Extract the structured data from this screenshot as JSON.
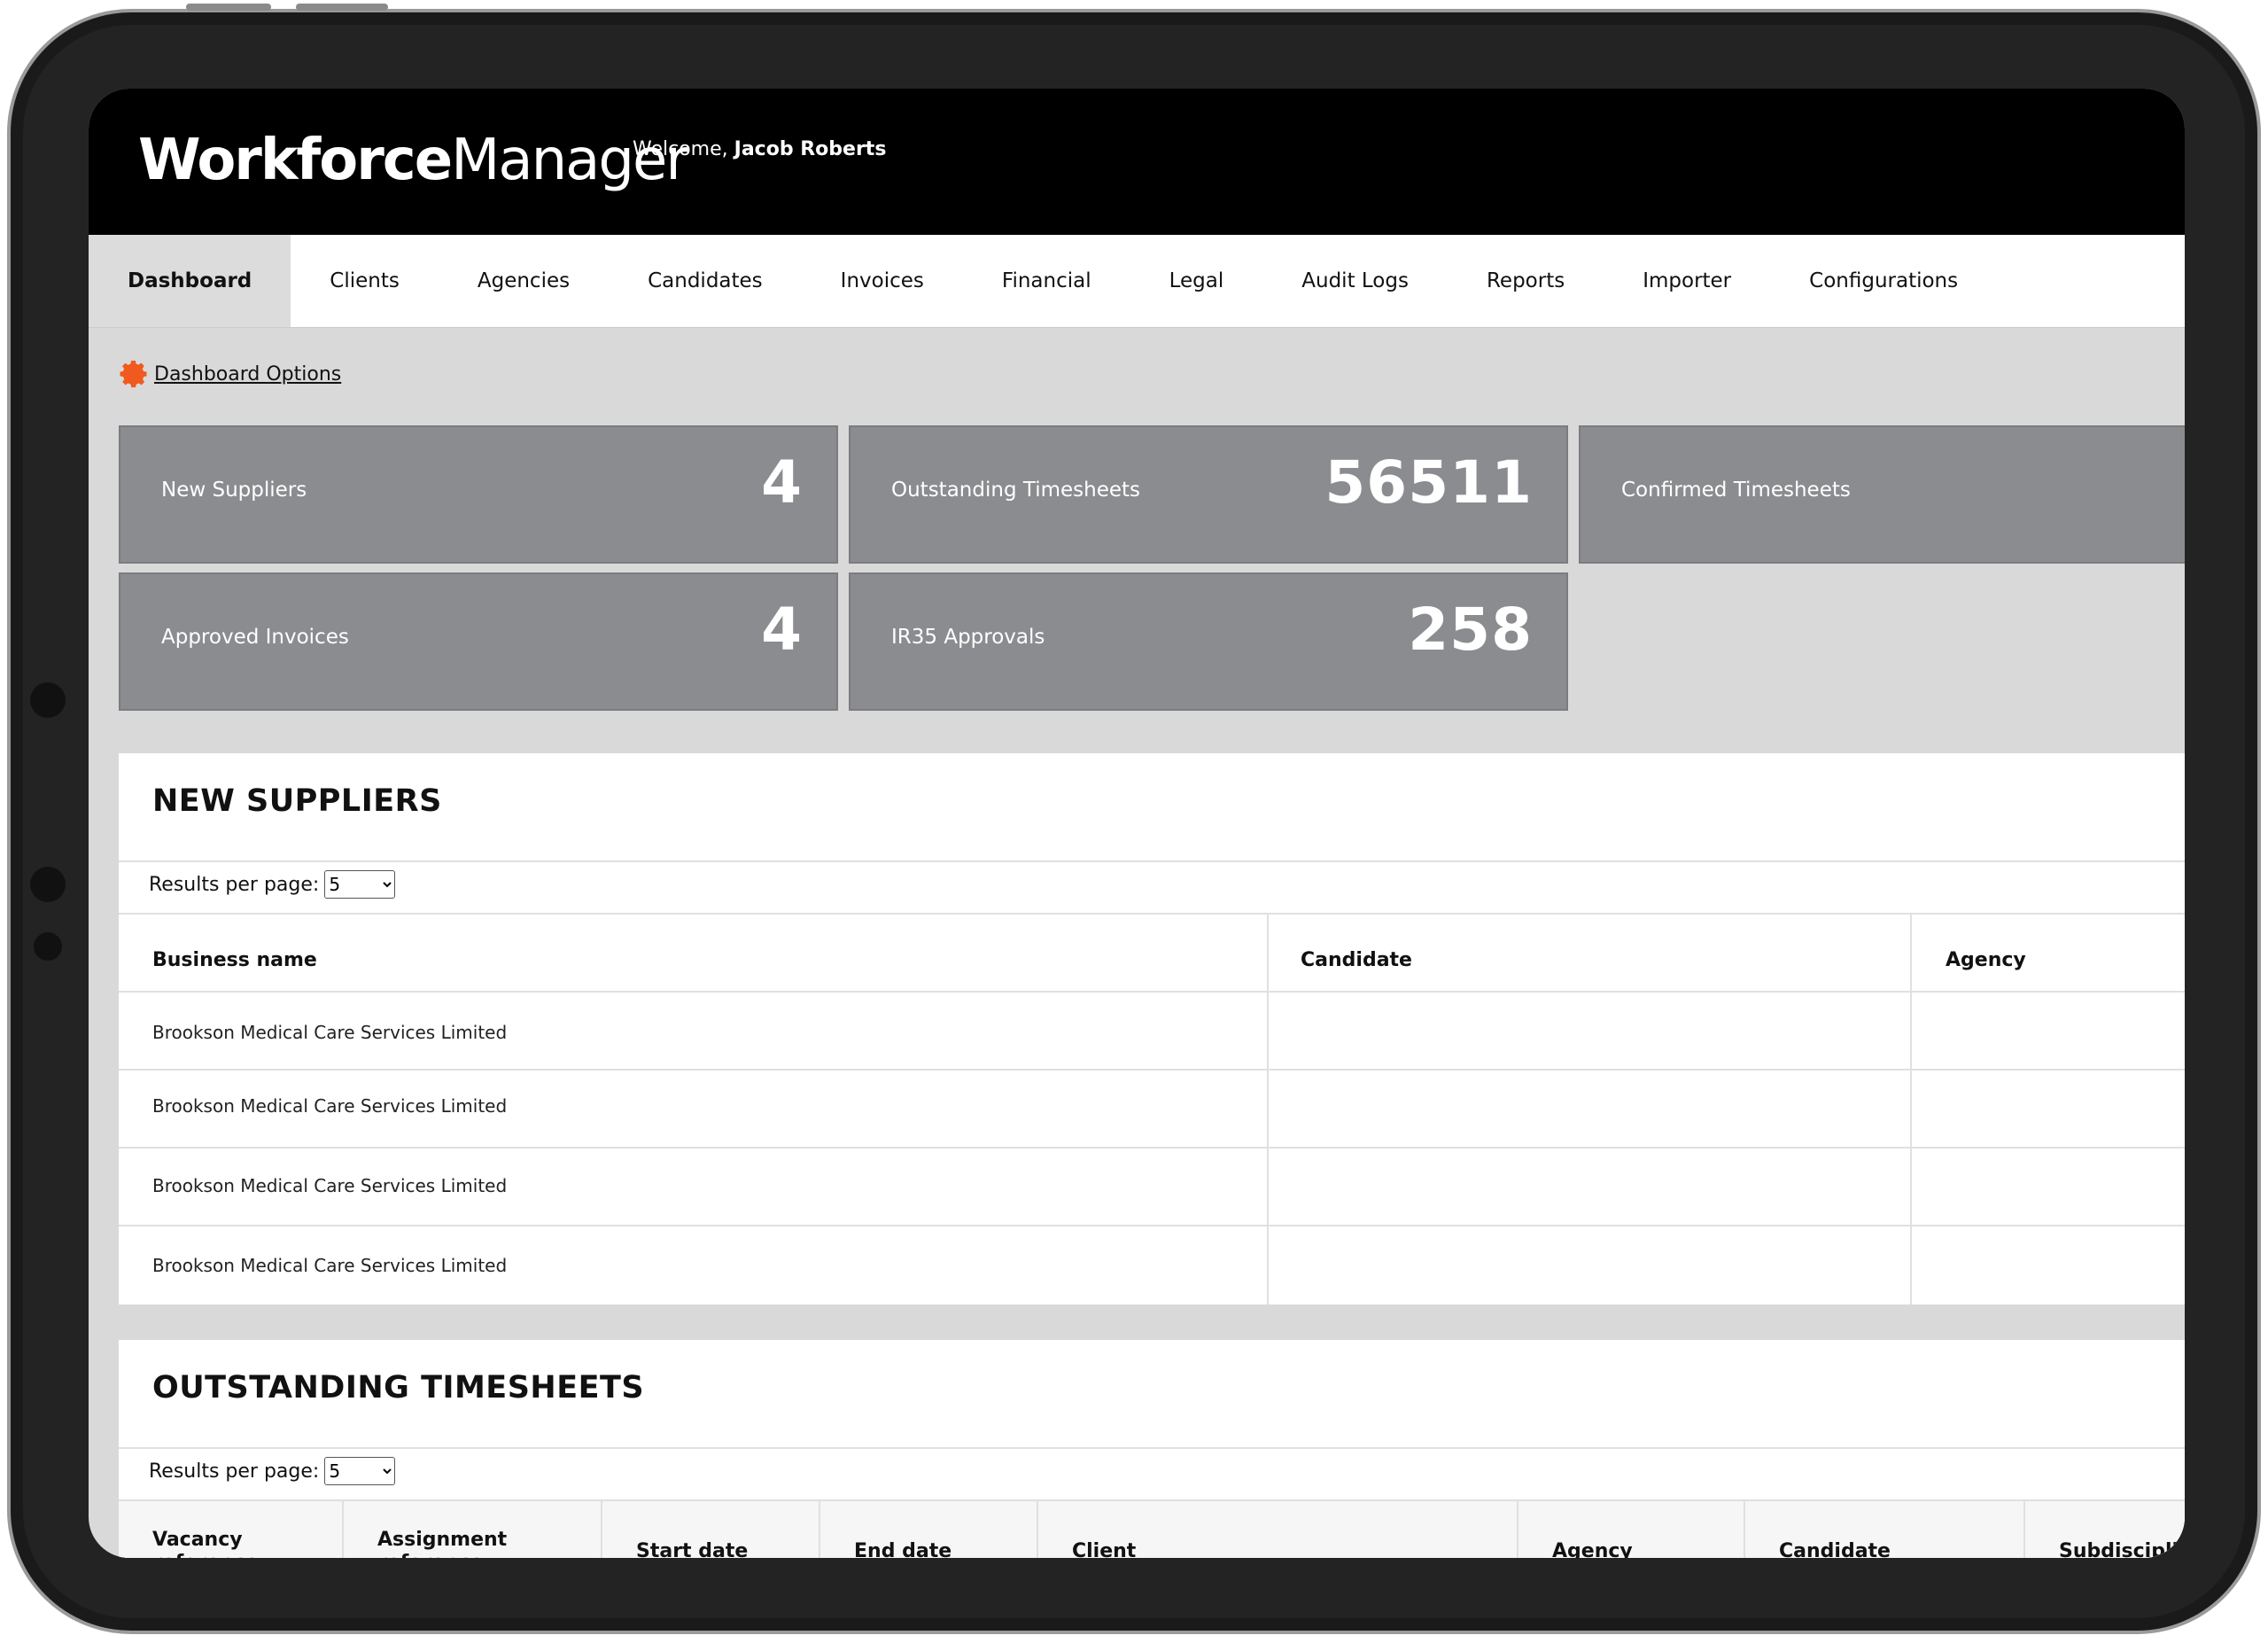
{
  "app": {
    "logo_bold": "Workforce",
    "logo_light": "Manager",
    "welcome_prefix": "Welcome,",
    "user_name": "Jacob Roberts"
  },
  "nav": {
    "items": [
      "Dashboard",
      "Clients",
      "Agencies",
      "Candidates",
      "Invoices",
      "Financial",
      "Legal",
      "Audit Logs",
      "Reports",
      "Importer",
      "Configurations"
    ],
    "active": "Dashboard"
  },
  "dashboard_options": {
    "label": "Dashboard Options",
    "icon": "gear-icon",
    "icon_color": "#f05a1e"
  },
  "cards": [
    {
      "label": "New Suppliers",
      "value": "4"
    },
    {
      "label": "Outstanding Timesheets",
      "value": "56511"
    },
    {
      "label": "Confirmed Timesheets",
      "value": ""
    },
    {
      "label": "Approved Invoices",
      "value": "4"
    },
    {
      "label": "IR35 Approvals",
      "value": "258"
    }
  ],
  "new_suppliers": {
    "title": "NEW SUPPLIERS",
    "results_label": "Results per page:",
    "results_value": "5",
    "columns": [
      "Business name",
      "Candidate",
      "Agency"
    ],
    "rows": [
      [
        "Brookson Medical Care Services Limited",
        "",
        ""
      ],
      [
        "Brookson Medical Care Services Limited",
        "",
        ""
      ],
      [
        "Brookson Medical Care Services Limited",
        "",
        ""
      ],
      [
        "Brookson Medical Care Services Limited",
        "",
        ""
      ]
    ]
  },
  "outstanding_timesheets": {
    "title": "OUTSTANDING TIMESHEETS",
    "results_label": "Results per page:",
    "results_value": "5",
    "columns": [
      "Vacancy reference",
      "Assignment reference",
      "Start date",
      "End date",
      "Client",
      "Agency",
      "Candidate",
      "Subdiscipline"
    ]
  },
  "colors": {
    "topbar": "#000000",
    "card": "#8b8c8f",
    "page_bg": "#d9d9d9",
    "accent": "#f05a1e"
  }
}
